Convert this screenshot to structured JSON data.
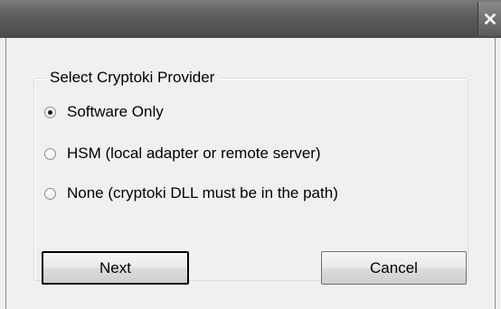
{
  "window": {
    "title": "",
    "close_icon": "close-icon"
  },
  "group": {
    "legend": "Select Cryptoki Provider",
    "options": [
      {
        "label": "Software Only",
        "checked": true
      },
      {
        "label": "HSM (local adapter or remote server)",
        "checked": false
      },
      {
        "label": "None (cryptoki DLL must be in the path)",
        "checked": false
      }
    ]
  },
  "buttons": {
    "next_label": "Next",
    "cancel_label": "Cancel"
  }
}
